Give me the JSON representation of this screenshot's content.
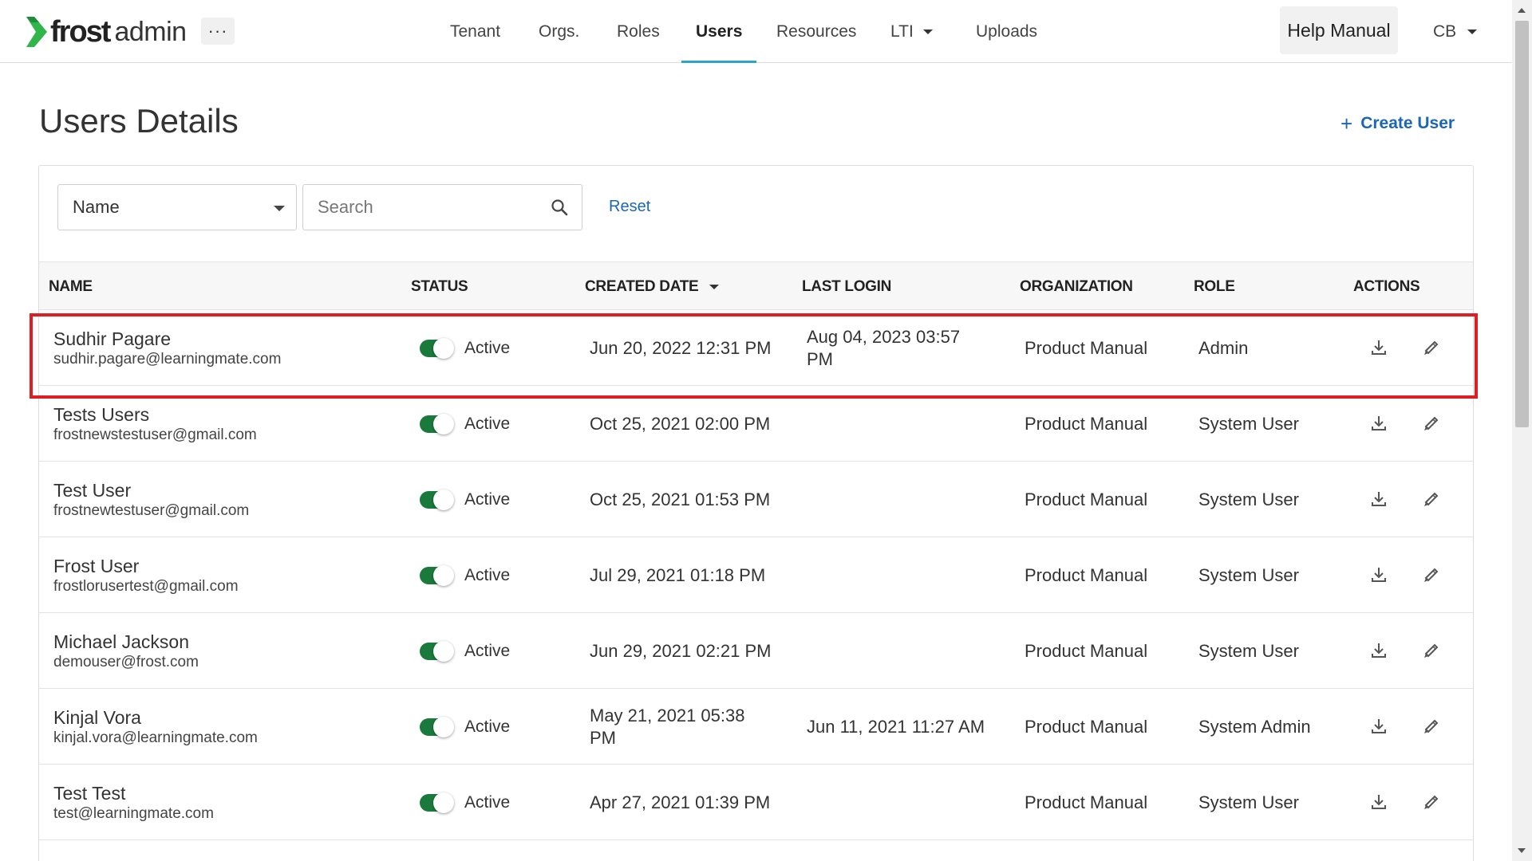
{
  "app": {
    "logo_frost": "frost",
    "logo_admin": "admin",
    "more_label": "···"
  },
  "nav": {
    "items": [
      {
        "label": "Tenant"
      },
      {
        "label": "Orgs."
      },
      {
        "label": "Roles"
      },
      {
        "label": "Users",
        "active": true
      },
      {
        "label": "Resources"
      },
      {
        "label": "LTI",
        "dropdown": true
      },
      {
        "label": "Uploads"
      }
    ],
    "help_label": "Help Manual",
    "user_initials": "CB"
  },
  "page": {
    "title": "Users Details",
    "create_label": "Create User",
    "create_icon": "plus-icon"
  },
  "filter": {
    "field_selected": "Name",
    "search_placeholder": "Search",
    "reset_label": "Reset"
  },
  "table": {
    "columns": [
      "NAME",
      "STATUS",
      "CREATED DATE",
      "LAST LOGIN",
      "ORGANIZATION",
      "ROLE",
      "ACTIONS"
    ],
    "sorted_column": "CREATED DATE",
    "rows": [
      {
        "name": "Sudhir Pagare",
        "email": "sudhir.pagare@learningmate.com",
        "status": "Active",
        "created": "Jun 20, 2022 12:31 PM",
        "last_login": "Aug 04, 2023 03:57 PM",
        "org": "Product Manual",
        "role": "Admin"
      },
      {
        "name": "Tests Users",
        "email": "frostnewstestuser@gmail.com",
        "status": "Active",
        "created": "Oct 25, 2021 02:00 PM",
        "last_login": "",
        "org": "Product Manual",
        "role": "System User"
      },
      {
        "name": "Test User",
        "email": "frostnewtestuser@gmail.com",
        "status": "Active",
        "created": "Oct 25, 2021 01:53 PM",
        "last_login": "",
        "org": "Product Manual",
        "role": "System User"
      },
      {
        "name": "Frost User",
        "email": "frostlorusertest@gmail.com",
        "status": "Active",
        "created": "Jul 29, 2021 01:18 PM",
        "last_login": "",
        "org": "Product Manual",
        "role": "System User"
      },
      {
        "name": "Michael Jackson",
        "email": "demouser@frost.com",
        "status": "Active",
        "created": "Jun 29, 2021 02:21 PM",
        "last_login": "",
        "org": "Product Manual",
        "role": "System User"
      },
      {
        "name": "Kinjal Vora",
        "email": "kinjal.vora@learningmate.com",
        "status": "Active",
        "created": "May 21, 2021 05:38 PM",
        "last_login": "Jun 11, 2021 11:27 AM",
        "org": "Product Manual",
        "role": "System Admin"
      },
      {
        "name": "Test Test",
        "email": "test@learningmate.com",
        "status": "Active",
        "created": "Apr 27, 2021 01:39 PM",
        "last_login": "",
        "org": "Product Manual",
        "role": "System User"
      }
    ]
  },
  "colors": {
    "accent": "#2aa6c9",
    "link": "#1c67b3",
    "toggle_on": "#1a7a3c",
    "highlight": "#dd1f24"
  }
}
